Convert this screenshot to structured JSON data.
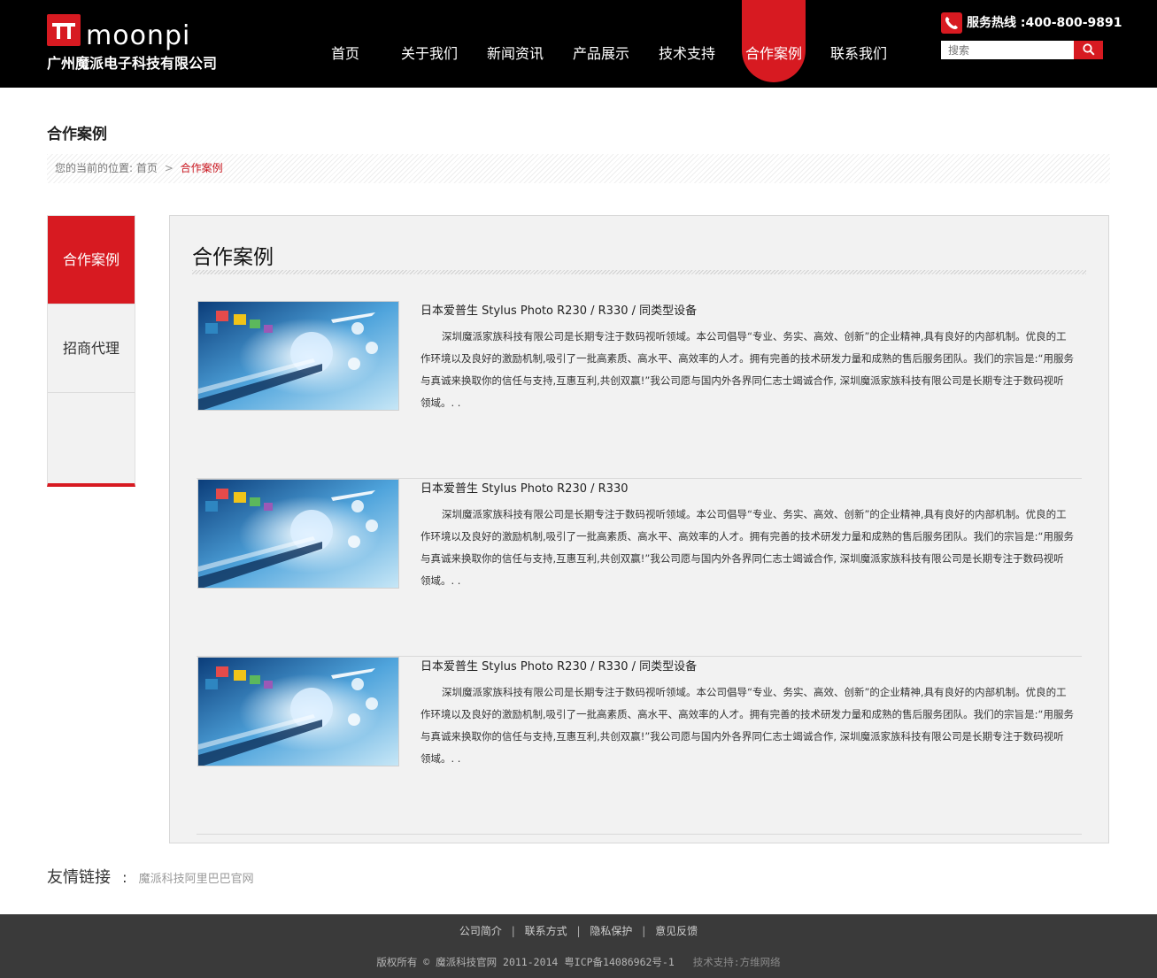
{
  "brand": {
    "logo_word": "moonpi",
    "company": "广州魔派电子科技有限公司"
  },
  "nav": {
    "items": [
      "首页",
      "关于我们",
      "新闻资讯",
      "产品展示",
      "技术支持",
      "合作案例",
      "联系我们"
    ],
    "active": "合作案例"
  },
  "hotline": {
    "label": "服务热线 :400-800-9891"
  },
  "search": {
    "placeholder": "搜索"
  },
  "page": {
    "title": "合作案例",
    "breadcrumb": {
      "prefix": "您的当前的位置:",
      "home": "首页",
      "separator": ">",
      "current": "合作案例"
    }
  },
  "sidebar": {
    "items": [
      "合作案例",
      "招商代理"
    ],
    "active": "合作案例"
  },
  "main": {
    "title": "合作案例",
    "cases": [
      {
        "title": "日本爱普生 Stylus Photo R230 / R330 / 同类型设备",
        "description": "深圳魔派家族科技有限公司是长期专注于数码视听领域。本公司倡导“专业、务实、高效、创新”的企业精神,具有良好的内部机制。优良的工作环境以及良好的激励机制,吸引了一批高素质、高水平、高效率的人才。拥有完善的技术研发力量和成熟的售后服务团队。我们的宗旨是:“用服务与真诚来换取你的信任与支持,互惠互利,共创双赢!”我公司愿与国内外各界同仁志士竭诚合作, 深圳魔派家族科技有限公司是长期专注于数码视听领域。. ."
      },
      {
        "title": "日本爱普生 Stylus Photo R230 / R330",
        "description": "深圳魔派家族科技有限公司是长期专注于数码视听领域。本公司倡导“专业、务实、高效、创新”的企业精神,具有良好的内部机制。优良的工作环境以及良好的激励机制,吸引了一批高素质、高水平、高效率的人才。拥有完善的技术研发力量和成熟的售后服务团队。我们的宗旨是:“用服务与真诚来换取你的信任与支持,互惠互利,共创双赢!”我公司愿与国内外各界同仁志士竭诚合作, 深圳魔派家族科技有限公司是长期专注于数码视听领域。. ."
      },
      {
        "title": "日本爱普生 Stylus Photo R230 / R330 / 同类型设备",
        "description": "深圳魔派家族科技有限公司是长期专注于数码视听领域。本公司倡导“专业、务实、高效、创新”的企业精神,具有良好的内部机制。优良的工作环境以及良好的激励机制,吸引了一批高素质、高水平、高效率的人才。拥有完善的技术研发力量和成熟的售后服务团队。我们的宗旨是:“用服务与真诚来换取你的信任与支持,互惠互利,共创双赢!”我公司愿与国内外各界同仁志士竭诚合作, 深圳魔派家族科技有限公司是长期专注于数码视听领域。. ."
      }
    ]
  },
  "friend_links": {
    "label": "友情链接",
    "colon": ":",
    "items": [
      "魔派科技阿里巴巴官网"
    ]
  },
  "footer": {
    "links": [
      "公司简介",
      "联系方式",
      "隐私保护",
      "意见反馈"
    ],
    "separator": "|",
    "copyright": "版权所有 © 魔派科技官网 2011-2014 粤ICP备14086962号-1",
    "support": "技术支持:方维网络"
  },
  "colors": {
    "brand_red": "#d71a21",
    "header_bg": "#000000",
    "footer_bg": "#3a3a3a",
    "panel_bg": "#f2f2f2"
  },
  "icons": {
    "phone": "phone-icon",
    "search": "search-icon",
    "breadcrumb_sep": "chevron-right-icon"
  }
}
